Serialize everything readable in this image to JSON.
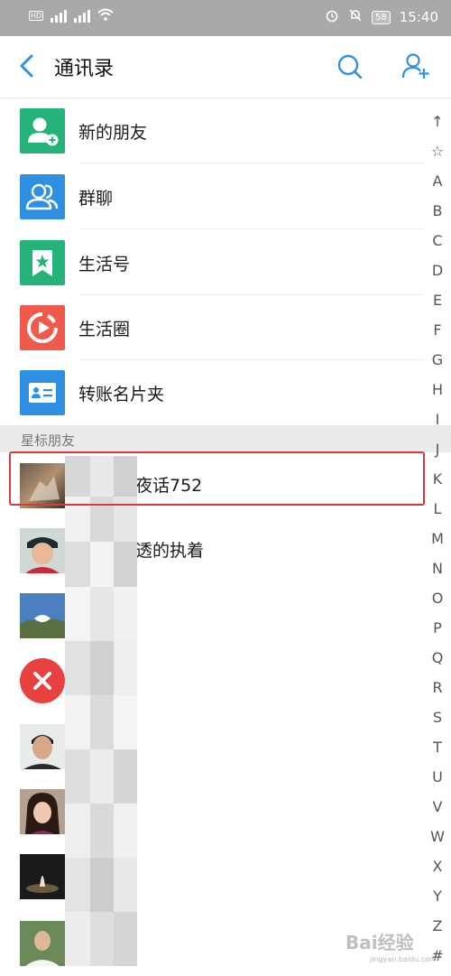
{
  "status_bar": {
    "time": "15:40",
    "battery": "58"
  },
  "header": {
    "title": "通讯录"
  },
  "fixed_items": [
    {
      "label": "新的朋友",
      "icon": "new-friend-icon",
      "color": "#25b37a"
    },
    {
      "label": "群聊",
      "icon": "group-chat-icon",
      "color": "#2f8fe0"
    },
    {
      "label": "生活号",
      "icon": "life-account-icon",
      "color": "#25b37a"
    },
    {
      "label": "生活圈",
      "icon": "life-circle-icon",
      "color": "#f05a4a"
    },
    {
      "label": "转账名片夹",
      "icon": "card-holder-icon",
      "color": "#2f8fe0"
    }
  ],
  "section": {
    "title": "星标朋友"
  },
  "contacts": [
    {
      "name": "夜话752"
    },
    {
      "name": "透的执着"
    },
    {
      "name": ""
    },
    {
      "name": ""
    },
    {
      "name": ""
    },
    {
      "name": ""
    },
    {
      "name": ""
    },
    {
      "name": ""
    }
  ],
  "alpha_index": [
    "↑",
    "☆",
    "A",
    "B",
    "C",
    "D",
    "E",
    "F",
    "G",
    "H",
    "I",
    "J",
    "K",
    "L",
    "M",
    "N",
    "O",
    "P",
    "Q",
    "R",
    "S",
    "T",
    "U",
    "V",
    "W",
    "X",
    "Y",
    "Z",
    "#"
  ],
  "watermark": {
    "text": "Bai经验",
    "sub": "jingyan.baidu.com"
  }
}
